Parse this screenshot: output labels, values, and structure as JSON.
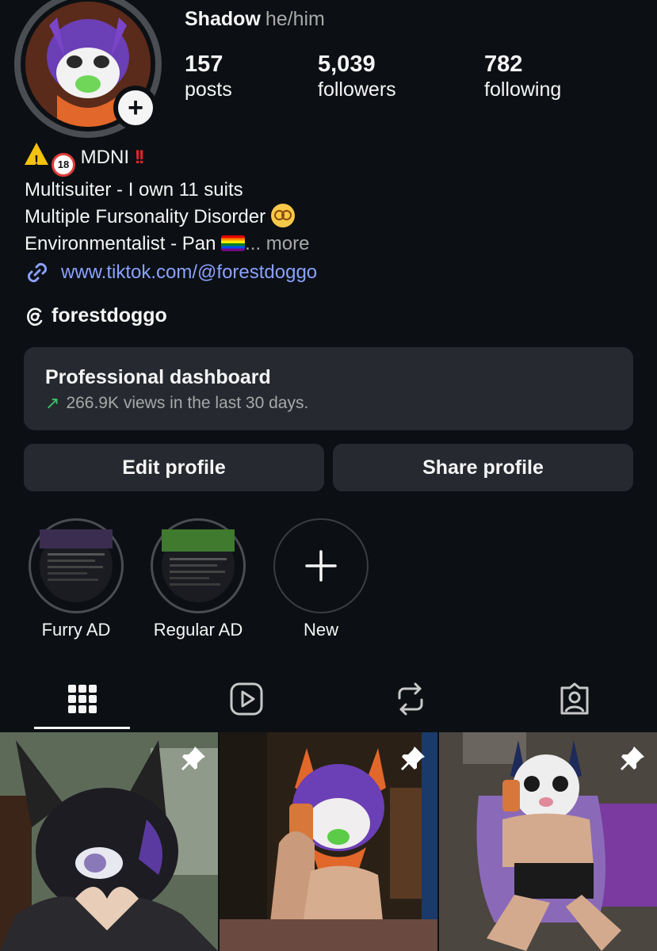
{
  "profile": {
    "name": "Shadow",
    "pronouns": "he/him",
    "stats": [
      {
        "value": "157",
        "label": "posts"
      },
      {
        "value": "5,039",
        "label": "followers"
      },
      {
        "value": "782",
        "label": "following"
      }
    ],
    "bio": {
      "line1_text": "MDNI",
      "line2": "Multisuiter - I own 11 suits",
      "line3": "Multiple Fursonality Disorder",
      "line4": "Environmentalist - Pan",
      "more": "... more"
    },
    "link": "www.tiktok.com/@forestdoggo",
    "threads_handle": "forestdoggo"
  },
  "dashboard": {
    "title": "Professional dashboard",
    "subtitle": "266.9K views in the last 30 days."
  },
  "buttons": {
    "edit": "Edit profile",
    "share": "Share profile"
  },
  "highlights": [
    {
      "label": "Furry AD"
    },
    {
      "label": "Regular AD"
    },
    {
      "label": "New"
    }
  ],
  "tabs": [
    {
      "icon": "grid-icon"
    },
    {
      "icon": "reels-icon"
    },
    {
      "icon": "reposts-icon"
    },
    {
      "icon": "tagged-icon"
    }
  ],
  "colors": {
    "background": "#0c1014",
    "card": "#262a30",
    "link": "#8aa1ff",
    "trend_up": "#3ec46d"
  }
}
